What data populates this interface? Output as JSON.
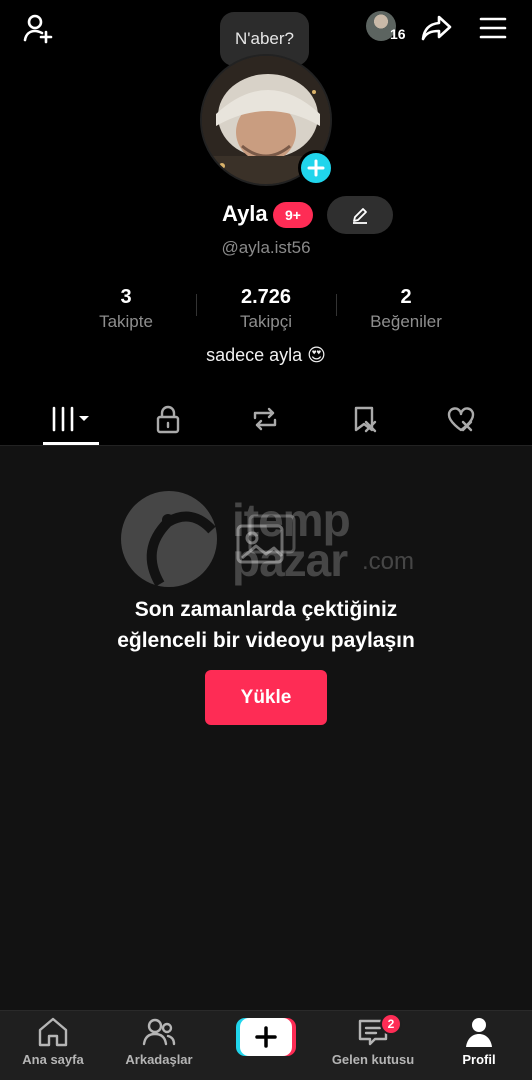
{
  "bubble": {
    "text": "N'aber?"
  },
  "topbar": {
    "friends_count": "16"
  },
  "profile": {
    "name": "Ayla",
    "badge": "9+",
    "handle": "@ayla.ist56",
    "bio": "sadece ayla 😍"
  },
  "stats": [
    {
      "value": "3",
      "label": "Takipte"
    },
    {
      "value": "2.726",
      "label": "Takipçi"
    },
    {
      "value": "2",
      "label": "Beğeniler"
    }
  ],
  "tabs": [
    {
      "icon": "grid-icon",
      "active": true
    },
    {
      "icon": "lock-icon",
      "active": false
    },
    {
      "icon": "repost-icon",
      "active": false
    },
    {
      "icon": "bookmark-icon",
      "active": false
    },
    {
      "icon": "liked-icon",
      "active": false
    }
  ],
  "empty_state": {
    "line1": "Son zamanlarda çektiğiniz",
    "line2": "eğlenceli bir videoyu paylaşın",
    "button": "Yükle"
  },
  "watermark": {
    "line1": "itemp",
    "line2": "pazar",
    "suffix": ".com"
  },
  "nav": {
    "items": [
      {
        "label": "Ana sayfa",
        "icon": "home-icon"
      },
      {
        "label": "Arkadaşlar",
        "icon": "friends-icon"
      },
      {
        "label": "",
        "icon": "create-icon"
      },
      {
        "label": "Gelen kutusu",
        "icon": "inbox-icon"
      },
      {
        "label": "Profil",
        "icon": "profile-icon"
      }
    ],
    "inbox_badge": "2"
  },
  "colors": {
    "accent": "#fe2c55",
    "cyan": "#20d5ec",
    "background": "#121212"
  }
}
